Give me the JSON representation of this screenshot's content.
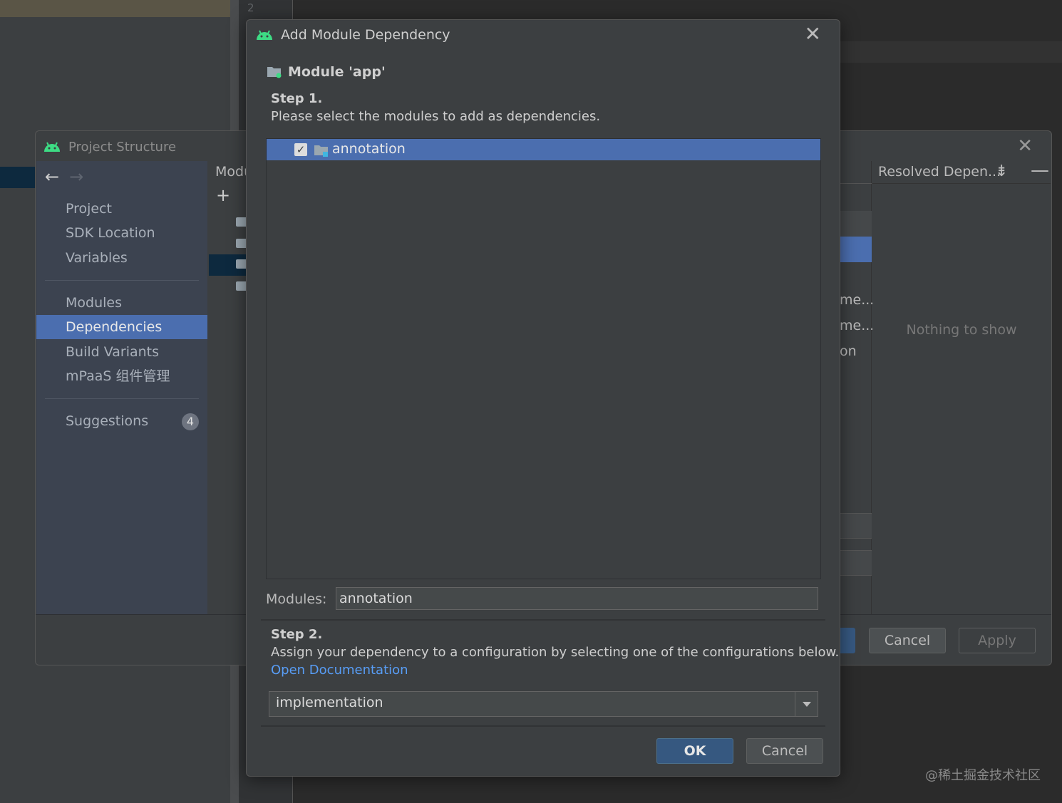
{
  "ide": {
    "gutter_line": "2"
  },
  "project_structure": {
    "title": "Project Structure",
    "nav_items": [
      {
        "label": "Project"
      },
      {
        "label": "SDK Location"
      },
      {
        "label": "Variables"
      },
      {
        "label": "Modules"
      },
      {
        "label": "Dependencies",
        "selected": true
      },
      {
        "label": "Build Variants"
      },
      {
        "label": "mPaaS 组件管理"
      },
      {
        "label": "Suggestions",
        "badge": "4"
      }
    ],
    "modules_header": "Modu",
    "right_strip_texts": [
      "me...",
      "me...",
      "on"
    ],
    "resolved_title": "Resolved Depen...",
    "resolved_empty": "Nothing to show",
    "cancel_label": "Cancel",
    "apply_label": "Apply"
  },
  "dialog": {
    "title": "Add Module Dependency",
    "module_heading": "Module 'app'",
    "step1_title": "Step 1.",
    "step1_desc": "Please select the modules to add as dependencies.",
    "modules": [
      {
        "name": "annotation",
        "checked": true
      }
    ],
    "modules_label": "Modules:",
    "modules_value": "annotation",
    "step2_title": "Step 2.",
    "step2_desc": "Assign your dependency to a configuration by selecting one of the configurations below.",
    "open_doc_label": "Open Documentation",
    "configuration": "implementation",
    "ok_label": "OK",
    "cancel_label": "Cancel"
  },
  "watermark": "@稀土掘金技术社区",
  "colors": {
    "selection": "#4b6eaf",
    "link": "#589df6",
    "ok_button": "#365880",
    "android_green": "#3ddc84"
  }
}
